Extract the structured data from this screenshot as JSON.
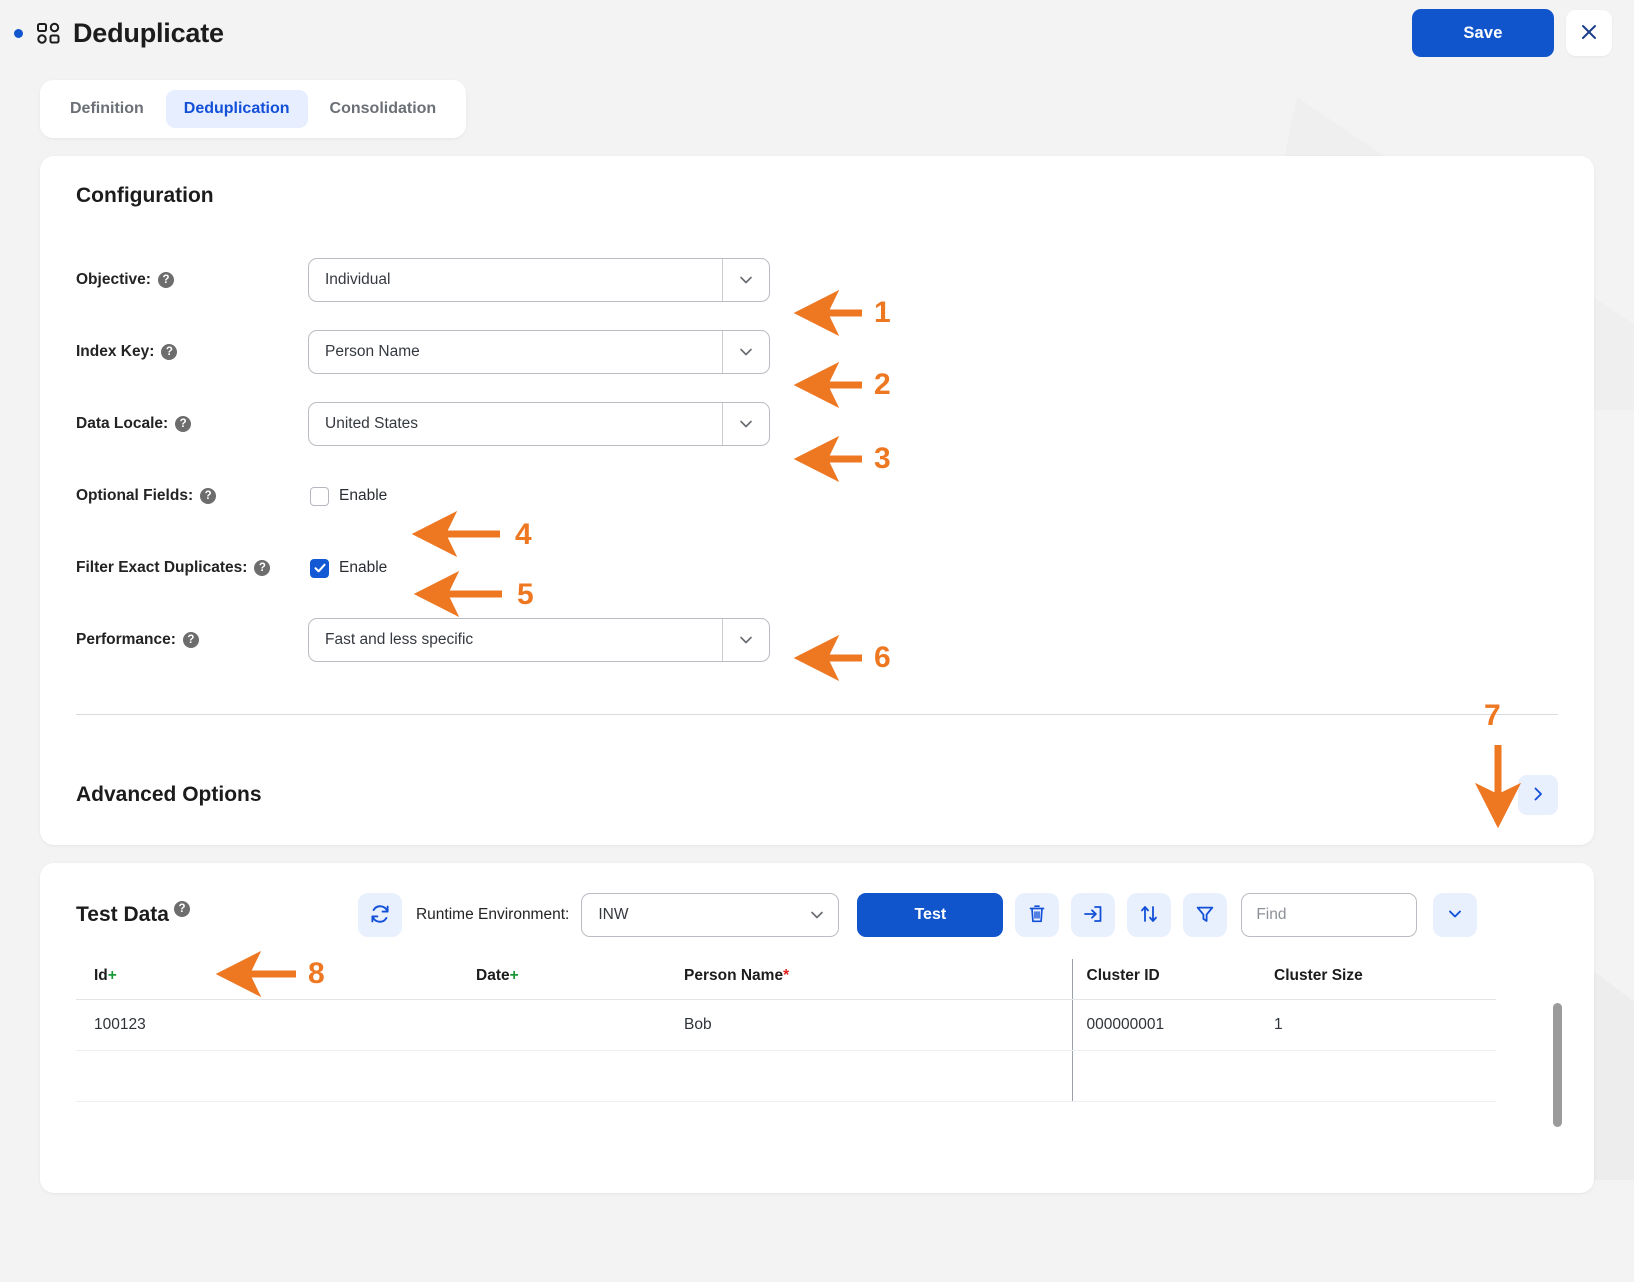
{
  "header": {
    "title": "Deduplicate",
    "save_label": "Save",
    "close_icon": "close-icon",
    "apps_icon": "grid-apps-icon",
    "accent_color": "#1155cc"
  },
  "tabs": [
    {
      "label": "Definition",
      "active": false
    },
    {
      "label": "Deduplication",
      "active": true
    },
    {
      "label": "Consolidation",
      "active": false
    }
  ],
  "configuration": {
    "title": "Configuration",
    "fields": {
      "objective": {
        "label": "Objective:",
        "value": "Individual"
      },
      "index_key": {
        "label": "Index Key:",
        "value": "Person Name"
      },
      "data_locale": {
        "label": "Data Locale:",
        "value": "United States"
      },
      "optional_fields": {
        "label": "Optional Fields:",
        "checkbox_label": "Enable",
        "checked": false
      },
      "filter_exact_duplicates": {
        "label": "Filter Exact Duplicates:",
        "checkbox_label": "Enable",
        "checked": true
      },
      "performance": {
        "label": "Performance:",
        "value": "Fast and less specific"
      }
    },
    "advanced_options": {
      "label": "Advanced Options",
      "expand_icon": "chevron-right-icon"
    }
  },
  "test_data": {
    "title": "Test Data",
    "refresh_icon": "refresh-icon",
    "runtime_label": "Runtime Environment:",
    "runtime_value": "INW",
    "test_button": "Test",
    "toolbar_icons": [
      "delete-icon",
      "import-icon",
      "sort-icon",
      "filter-icon"
    ],
    "find_placeholder": "Find",
    "expand_icon": "chevron-down-icon",
    "columns": [
      {
        "label": "Id",
        "marker": "+",
        "marker_type": "plus"
      },
      {
        "label": "Date",
        "marker": "+",
        "marker_type": "plus"
      },
      {
        "label": "Person Name",
        "marker": "*",
        "marker_type": "required"
      },
      {
        "label": "Cluster ID",
        "marker": "",
        "marker_type": "none"
      },
      {
        "label": "Cluster Size",
        "marker": "",
        "marker_type": "none"
      }
    ],
    "rows": [
      {
        "id": "100123",
        "date": "",
        "person_name": "Bob",
        "cluster_id": "000000001",
        "cluster_size": "1"
      }
    ]
  },
  "annotations": {
    "color": "#ee7722",
    "markers": [
      {
        "number": "1",
        "target": "objective-select"
      },
      {
        "number": "2",
        "target": "index-key-select"
      },
      {
        "number": "3",
        "target": "data-locale-select"
      },
      {
        "number": "4",
        "target": "optional-fields-checkbox"
      },
      {
        "number": "5",
        "target": "filter-exact-duplicates-checkbox"
      },
      {
        "number": "6",
        "target": "performance-select"
      },
      {
        "number": "7",
        "target": "advanced-options-expand-button"
      },
      {
        "number": "8",
        "target": "test-data-title"
      }
    ]
  }
}
